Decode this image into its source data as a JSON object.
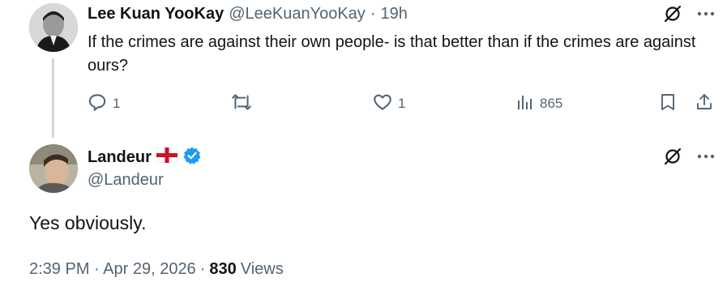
{
  "parent": {
    "display_name": "Lee Kuan YooKay",
    "handle": "@LeeKuanYooKay",
    "separator": "·",
    "time": "19h",
    "text": "If the crimes are against their own people- is that better than if the crimes are against ours?",
    "actions": {
      "reply_count": "1",
      "like_count": "1",
      "view_count": "865"
    }
  },
  "reply": {
    "display_name": "Landeur",
    "flag": "England flag",
    "verified": true,
    "handle": "@Landeur",
    "text": "Yes obviously.",
    "timestamp": "2:39 PM · Apr 29, 2026",
    "dot": "·",
    "views_count": "830",
    "views_label": "Views"
  },
  "colors": {
    "text": "#0f1419",
    "muted": "#536471",
    "verified": "#1d9bf0",
    "thread_line": "#cfd9de"
  },
  "icons": [
    "grok-icon",
    "more-icon",
    "reply-icon",
    "retweet-icon",
    "like-icon",
    "views-icon",
    "bookmark-icon",
    "share-icon",
    "verified-badge-icon",
    "england-flag-icon"
  ]
}
